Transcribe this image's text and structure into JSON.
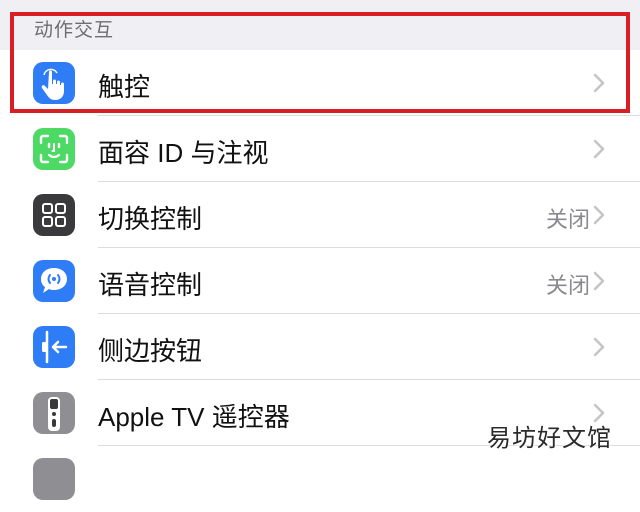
{
  "section": {
    "title": "动作交互"
  },
  "rows": [
    {
      "label": "触控",
      "value": "",
      "icon": "touch-hand-icon",
      "color": "#2f7df6"
    },
    {
      "label": "面容 ID 与注视",
      "value": "",
      "icon": "face-id-icon",
      "color": "#4cd964"
    },
    {
      "label": "切换控制",
      "value": "关闭",
      "icon": "switch-control-icon",
      "color": "#3a3a3c"
    },
    {
      "label": "语音控制",
      "value": "关闭",
      "icon": "voice-control-icon",
      "color": "#2f7df6"
    },
    {
      "label": "侧边按钮",
      "value": "",
      "icon": "side-button-icon",
      "color": "#2f7df6"
    },
    {
      "label": "Apple TV 遥控器",
      "value": "",
      "icon": "tv-remote-icon",
      "color": "#8e8e93"
    }
  ],
  "watermark": "易坊好文馆",
  "colors": {
    "highlight": "#d81f26",
    "background": "#f2f2f7"
  }
}
